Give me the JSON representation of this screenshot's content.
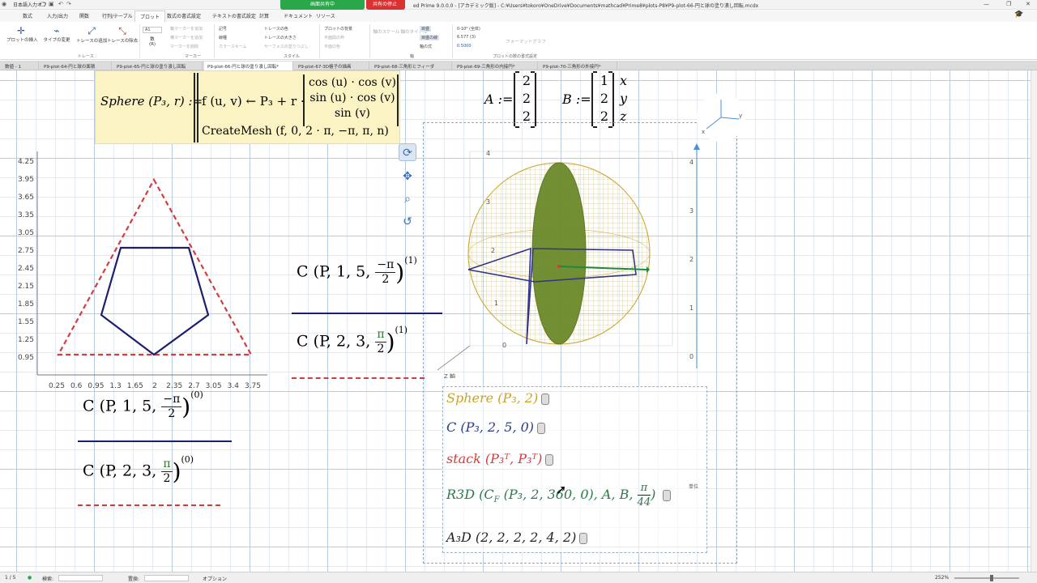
{
  "titlebar": {
    "ime": "日本語入力オフ",
    "share_on": "画面共有中",
    "share_stop": "共有の停止",
    "title": "ed Prime 9.0.0.0 - [アカデミック版] - C:¥Users¥tokoro¥OneDrive¥Documents¥mathcad¥Prime8¥plots-P8¥P9-plot-66-円と球の塗り潰し回転.mcdx"
  },
  "ribbon_tabs": [
    "数式",
    "入力/出力",
    "関数",
    "行列/テーブル",
    "プロット",
    "数式の書式設定",
    "テキストの書式設定",
    "計算",
    "ドキュメント",
    "リソース"
  ],
  "ribbon": {
    "insert_plot": "プロットの挿入",
    "change_plot_type": "タイプの変更",
    "add_trace": "トレースの追加",
    "remove_trace": "トレースの除去",
    "trace_group": "トレース",
    "marker_field": "A1",
    "number_label": "数",
    "number_sub": "(R)",
    "add_marker": "軸マーカーを追加",
    "add_horizontal": "横マーカーを追加",
    "remove_marker": "マーカーを削除",
    "marker_group": "マーカー",
    "symbol": "記号",
    "line_type": "線種",
    "color_scheme": "カラースキーム",
    "trace_color": "トレースの色",
    "trace_size": "トレースの大きさ",
    "surface_fill": "サーフェスの塗りつぶし",
    "style_group": "スタイル",
    "plot_background": "プロットの背景",
    "plot_frame": "平面間の枠",
    "surface_color": "平面の色",
    "perspective": "パース",
    "axis_scale": "軸のスケール",
    "axis_title": "軸のタイトル",
    "axes_group": "軸",
    "grid": "目盛",
    "grid_lines": "目盛の線",
    "axis_style": "軸の式",
    "num_format": "0-10⁶ (全体)",
    "precision": "6.577 (3)",
    "zero_tolerance": "0.5000",
    "format_group": "プロットの数の書式設定",
    "format_graph": "フォーマットグラフ"
  },
  "doc_tabs": [
    "数値 - 1",
    "P9-plot-64-円と球の面積",
    "P9-plot-65-円と球の塗り潰し回転",
    "P9-plot-66-円と球の塗り潰し回転*",
    "P9-plot-67-3D格子の描画",
    "P9-plot-68-三角形とフィーダ",
    "P9-plot-69-三角形の内接円*",
    "P9-plot-70-三角形の外接円*"
  ],
  "sheet": {
    "sphere_def": {
      "label": "Sphere (P₃, r) :=",
      "body_head": "f (u, v) ← P₃ + r ·",
      "m1": "cos (u) · cos (v)",
      "m2": "sin (u) · cos (v)",
      "m3": "sin (v)",
      "create_mesh": "CreateMesh (f, 0, 2 · π, −π, π, n)"
    },
    "vec_A": {
      "label": "A :=",
      "values": [
        "2",
        "2",
        "2"
      ]
    },
    "vec_B": {
      "label": "B :=",
      "values": [
        "1",
        "2",
        "2"
      ],
      "axes": [
        "x",
        "y",
        "z"
      ]
    },
    "plot2d": {
      "yticks": [
        "4.25",
        "3.95",
        "3.65",
        "3.35",
        "3.05",
        "2.75",
        "2.45",
        "2.15",
        "1.85",
        "1.55",
        "1.25",
        "0.95"
      ],
      "xticks": [
        "0.25",
        "0.6",
        "0.95",
        "1.3",
        "1.65",
        "2",
        "2.35",
        "2.7",
        "3.05",
        "3.4",
        "3.75"
      ]
    },
    "legend": {
      "c1_full": "C (P, 1, 5,",
      "c1_num": "−π",
      "c1_den": "2",
      "c1_sup1": "(1)",
      "c1_sup0": "(0)",
      "c2_full": "C (P, 2, 3,",
      "c2_num": "π",
      "c2_den": "2",
      "c2_sup1": "(1)",
      "c2_sup0": "(0)"
    },
    "plot3d": {
      "z_ticks_left": [
        "4",
        "3",
        "2",
        "1",
        "0"
      ],
      "z_ticks_right": [
        "4",
        "3",
        "2",
        "1",
        "0"
      ],
      "z_axis_label": "Z 軸",
      "axis_y": "y",
      "axis_x": "x"
    },
    "results": {
      "r1": "Sphere (P₃, 2)",
      "r2": "C (P₃, 2, 5, 0)",
      "r3": "stack (P₃ᵀ, P₃ᵀ)",
      "r4_head": "R3D (C",
      "r4_sub": "F",
      "r4_args": "(P₃, 2, 360, 0), A, B,",
      "r4_num": "π",
      "r4_den": "44",
      "r5": "A₃D (2, 2, 2, 2, 4, 2)",
      "unit": "単位"
    }
  },
  "status": {
    "page": "1 / 5",
    "find": "検索:",
    "replace": "置換:",
    "options": "オプション",
    "zoom": "252%"
  },
  "colors": {
    "red": "#d43c3c",
    "navy": "#1c1f6e",
    "gold": "#c9a227",
    "green": "#2a7a2a",
    "sphere_fill": "#6b8a2a"
  }
}
